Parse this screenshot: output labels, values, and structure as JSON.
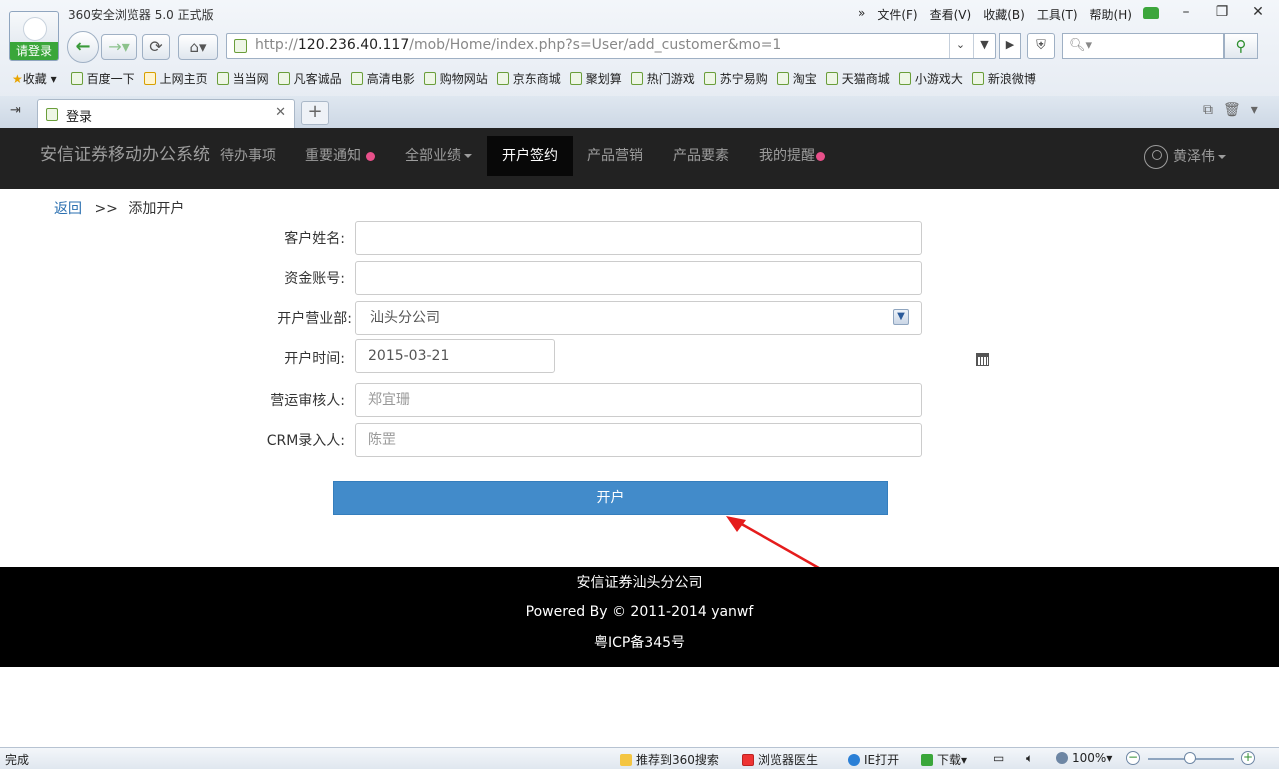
{
  "browser": {
    "title": "360安全浏览器 5.0 正式版",
    "login_badge": "请登录",
    "menu": [
      "»",
      "文件(F)",
      "查看(V)",
      "收藏(B)",
      "工具(T)",
      "帮助(H)"
    ],
    "url_prefix": "http://",
    "url_host": "120.236.40.117",
    "url_path": "/mob/Home/index.php?s=User/add_customer&mo=1",
    "favorites_label": "收藏",
    "bookmarks": [
      "百度一下",
      "上网主页",
      "当当网",
      "凡客诚品",
      "高清电影",
      "购物网站",
      "京东商城",
      "聚划算",
      "热门游戏",
      "苏宁易购",
      "淘宝",
      "天猫商城",
      "小游戏大",
      "新浪微博"
    ],
    "tab_label": "登录",
    "status": "完成",
    "statusbar_items": [
      "推荐到360搜索",
      "浏览器医生",
      "IE打开",
      "下载",
      "100%"
    ]
  },
  "navbar": {
    "brand": "安信证券移动办公系统",
    "items": [
      {
        "label": "待办事项"
      },
      {
        "label": "重要通知"
      },
      {
        "label": "全部业绩"
      },
      {
        "label": "开户签约"
      },
      {
        "label": "产品营销"
      },
      {
        "label": "产品要素"
      },
      {
        "label": "我的提醒"
      }
    ],
    "user": "黄泽伟"
  },
  "breadcrumb": {
    "back": "返回",
    "sep": ">>",
    "current": "添加开户"
  },
  "form": {
    "name_label": "客户姓名:",
    "name_value": "",
    "account_label": "资金账号:",
    "account_value": "",
    "branch_label": "开户营业部:",
    "branch_value": "汕头分公司",
    "date_label": "开户时间:",
    "date_value": "2015-03-21",
    "reviewer_label": "营运审核人:",
    "reviewer_placeholder": "郑宜珊",
    "crm_label": "CRM录入人:",
    "crm_placeholder": "陈罡",
    "submit": "开户"
  },
  "footer": {
    "company": "安信证券汕头分公司",
    "powered": "Powered By © 2011-2014 yanwf",
    "icp": "粤ICP备345号"
  },
  "colors": {
    "navbar_bg": "#222222",
    "primary_button": "#428bca",
    "footer_bg": "#000000",
    "alert_dot": "#e8508a",
    "annotation_arrow": "#e51c1c"
  }
}
